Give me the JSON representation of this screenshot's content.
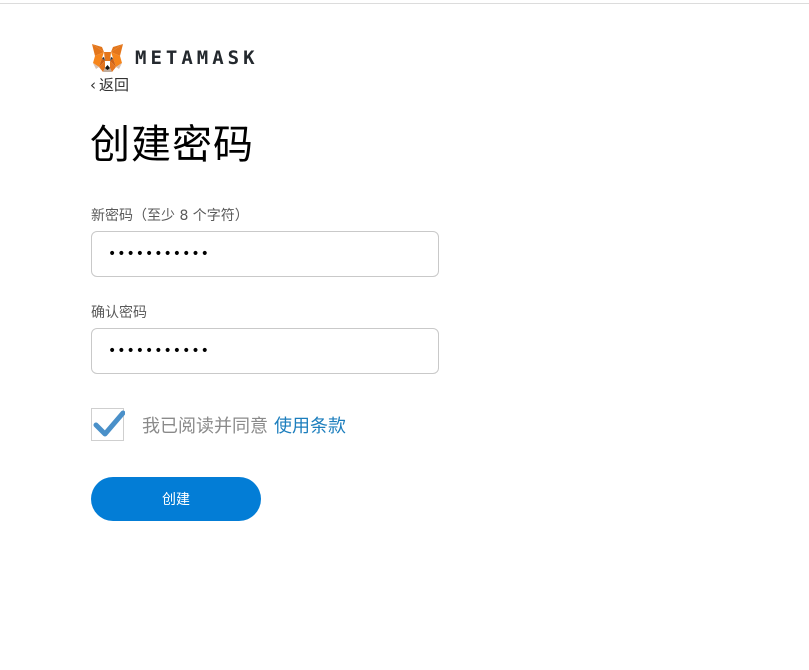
{
  "brand": {
    "name": "METAMASK",
    "logo_icon": "metamask-fox-icon"
  },
  "nav": {
    "back_label": "返回",
    "back_icon": "chevron-left-icon"
  },
  "page": {
    "title": "创建密码"
  },
  "form": {
    "new_password": {
      "label": "新密码（至少 8 个字符）",
      "value": "•••••••••••"
    },
    "confirm_password": {
      "label": "确认密码",
      "value": "•••••••••••"
    },
    "terms": {
      "checked": true,
      "text": "我已阅读并同意",
      "link_text": "使用条款"
    },
    "submit_label": "创建"
  },
  "colors": {
    "primary": "#037dd6",
    "link": "#1c7ebd",
    "checkmark": "#4a90c9",
    "fox_orange": "#e2761b"
  }
}
